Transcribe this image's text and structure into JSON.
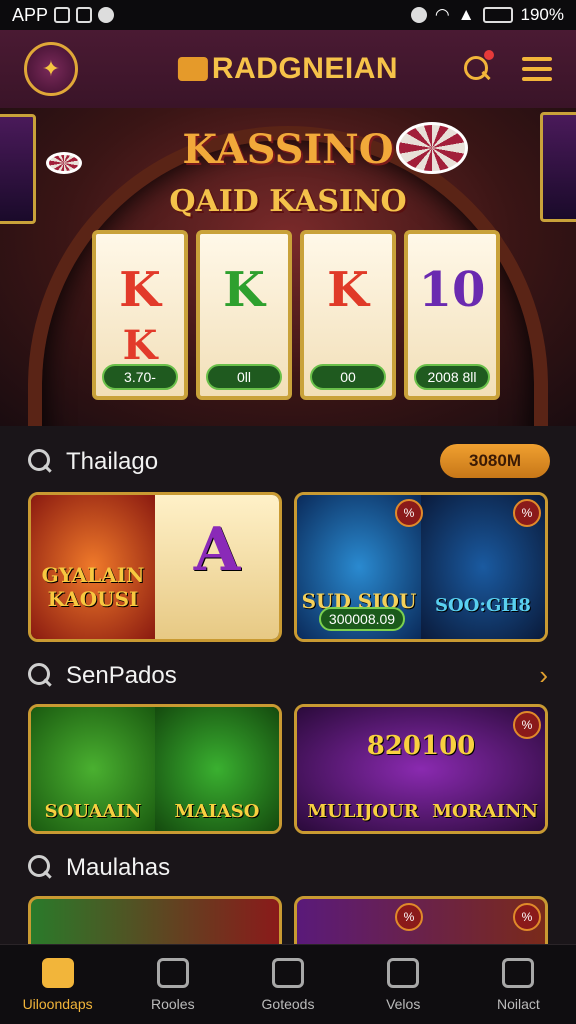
{
  "status_bar": {
    "app": "APP",
    "battery": "190%"
  },
  "header": {
    "brand": "RADGNEIAN"
  },
  "hero": {
    "title": "KASSINO",
    "subtitle": "QAID KASINO",
    "reels": [
      {
        "top": "K",
        "bottom": "K",
        "label": "3.70-",
        "top_color": "#e23a2a"
      },
      {
        "top": "K",
        "bottom": "",
        "label": "0ll",
        "top_color": "#2ea02e"
      },
      {
        "top": "K",
        "bottom": "",
        "label": "00",
        "top_color": "#e03a28"
      },
      {
        "top": "10",
        "bottom": "",
        "label": "2008 8ll",
        "top_color": "#6a2ab0"
      }
    ]
  },
  "sections": [
    {
      "title": "Thailago",
      "pill": "3080M"
    },
    {
      "title": "SenPados"
    },
    {
      "title": "Maulahas"
    }
  ],
  "cards": {
    "row1": [
      {
        "left_text": "GYALAIN KAOUSI",
        "right_text": "A",
        "badge": ""
      },
      {
        "left_text": "SUD SIOU",
        "right_text": "SOO:GH8",
        "badge": "300008.09"
      }
    ],
    "row2": [
      {
        "left_text": "SOUAAIN",
        "right_text": "MAIASO"
      },
      {
        "left_text": "MULIJOUR",
        "right_text": "MORAINN",
        "center_text": "820100"
      }
    ]
  },
  "tabbar": {
    "items": [
      {
        "label": "Uiloondaps",
        "icon": "home-icon"
      },
      {
        "label": "Rooles",
        "icon": "search-icon"
      },
      {
        "label": "Goteods",
        "icon": "lock-icon"
      },
      {
        "label": "Velos",
        "icon": "dial-icon"
      },
      {
        "label": "Noilact",
        "icon": "bag-icon"
      }
    ]
  }
}
